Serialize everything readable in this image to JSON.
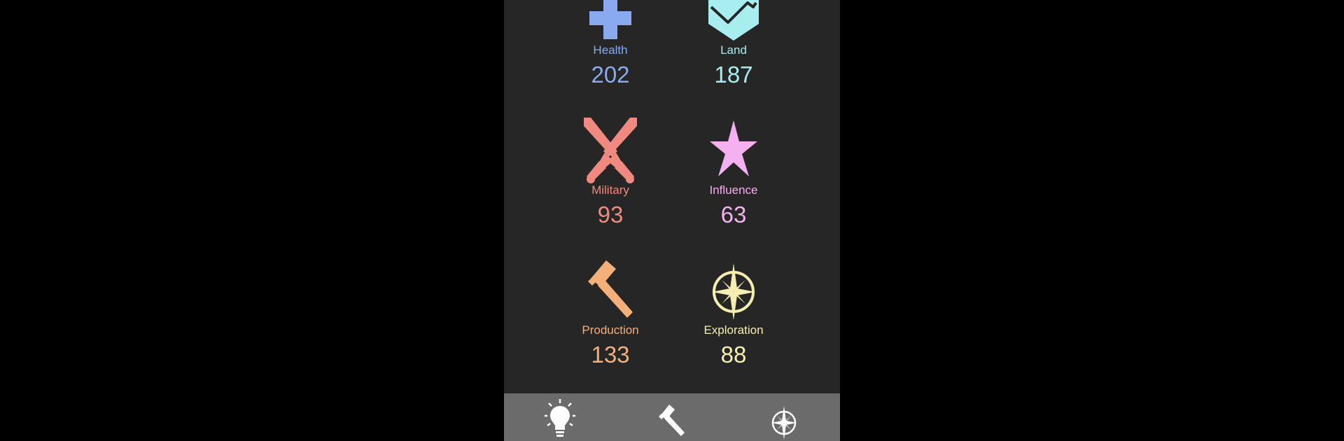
{
  "stats": {
    "health": {
      "label": "Health",
      "value": "202",
      "icon": "health-cross-icon",
      "color": "#8aaaf0"
    },
    "land": {
      "label": "Land",
      "value": "187",
      "icon": "land-shield-icon",
      "color": "#a8eef0"
    },
    "military": {
      "label": "Military",
      "value": "93",
      "icon": "crossed-swords-icon",
      "color": "#f08a80"
    },
    "influence": {
      "label": "Influence",
      "value": "63",
      "icon": "star-icon",
      "color": "#f5b0f0"
    },
    "production": {
      "label": "Production",
      "value": "133",
      "icon": "hammer-icon",
      "color": "#f5b07a"
    },
    "exploration": {
      "label": "Exploration",
      "value": "88",
      "icon": "compass-rose-icon",
      "color": "#f5eeb0"
    }
  },
  "navbar": {
    "items": [
      {
        "icon": "lightbulb-icon"
      },
      {
        "icon": "hammer-icon"
      },
      {
        "icon": "compass-rose-icon"
      }
    ],
    "background": "#6b6b6b",
    "icon_color": "#ffffff"
  }
}
